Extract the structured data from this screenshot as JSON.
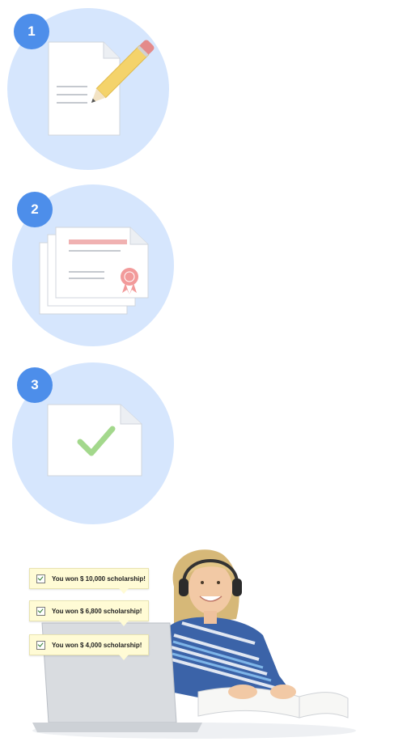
{
  "steps": [
    {
      "number": "1",
      "icon": "document-pencil-icon"
    },
    {
      "number": "2",
      "icon": "certificate-stack-icon"
    },
    {
      "number": "3",
      "icon": "document-checkmark-icon"
    }
  ],
  "hero": {
    "notifications": [
      "You won $ 10,000 scholarship!",
      "You won $ 6,800 scholarship!",
      "You won $ 4,000 scholarship!"
    ]
  },
  "colors": {
    "circle_bg": "#d6e6fd",
    "badge_bg": "#4d8eea",
    "pencil": "#f4d36b",
    "eraser": "#e48a8a",
    "seal": "#f29a9a",
    "check": "#a3d88c",
    "notification_bg": "#fffbd5"
  }
}
